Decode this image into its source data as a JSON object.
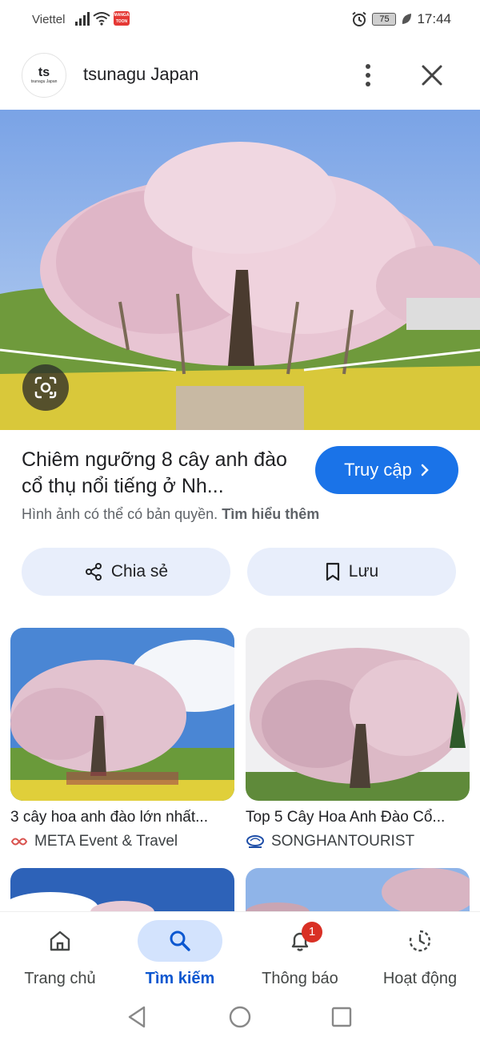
{
  "status_bar": {
    "carrier": "Viettel",
    "battery": "75",
    "time": "17:44",
    "manga_badge": "MANGA TOON"
  },
  "header": {
    "site_name": "tsunagu Japan",
    "logo_text": "tsunagu Japan",
    "logo_mark": "ts"
  },
  "result": {
    "title": "Chiêm ngưỡng 8 cây anh đào cổ thụ nổi tiếng ở Nh...",
    "visit_label": "Truy cập",
    "copyright_text": "Hình ảnh có thể có bản quyền.",
    "learn_more": "Tìm hiểu thêm"
  },
  "actions": {
    "share_label": "Chia sẻ",
    "save_label": "Lưu"
  },
  "related": [
    {
      "caption": "3 cây hoa anh đào lớn nhất...",
      "source": "META Event & Travel"
    },
    {
      "caption": "Top 5 Cây Hoa Anh Đào Cổ...",
      "source": "SONGHANTOURIST"
    }
  ],
  "bottom_nav": {
    "home": "Trang chủ",
    "search": "Tìm kiếm",
    "notifications": "Thông báo",
    "notification_count": "1",
    "activity": "Hoạt động"
  },
  "colors": {
    "accent": "#1a73e8",
    "action_bg": "#e8eefb",
    "nav_active_bg": "#d3e3fd",
    "badge": "#d93025"
  },
  "icons": [
    "signal-icon",
    "wifi-icon",
    "alarm-icon",
    "leaf-icon",
    "more-vert-icon",
    "close-icon",
    "lens-icon",
    "chevron-right-icon",
    "share-icon",
    "bookmark-icon",
    "home-icon",
    "search-icon",
    "bell-icon",
    "activity-icon",
    "back-icon",
    "home-circle-icon",
    "recents-icon"
  ]
}
